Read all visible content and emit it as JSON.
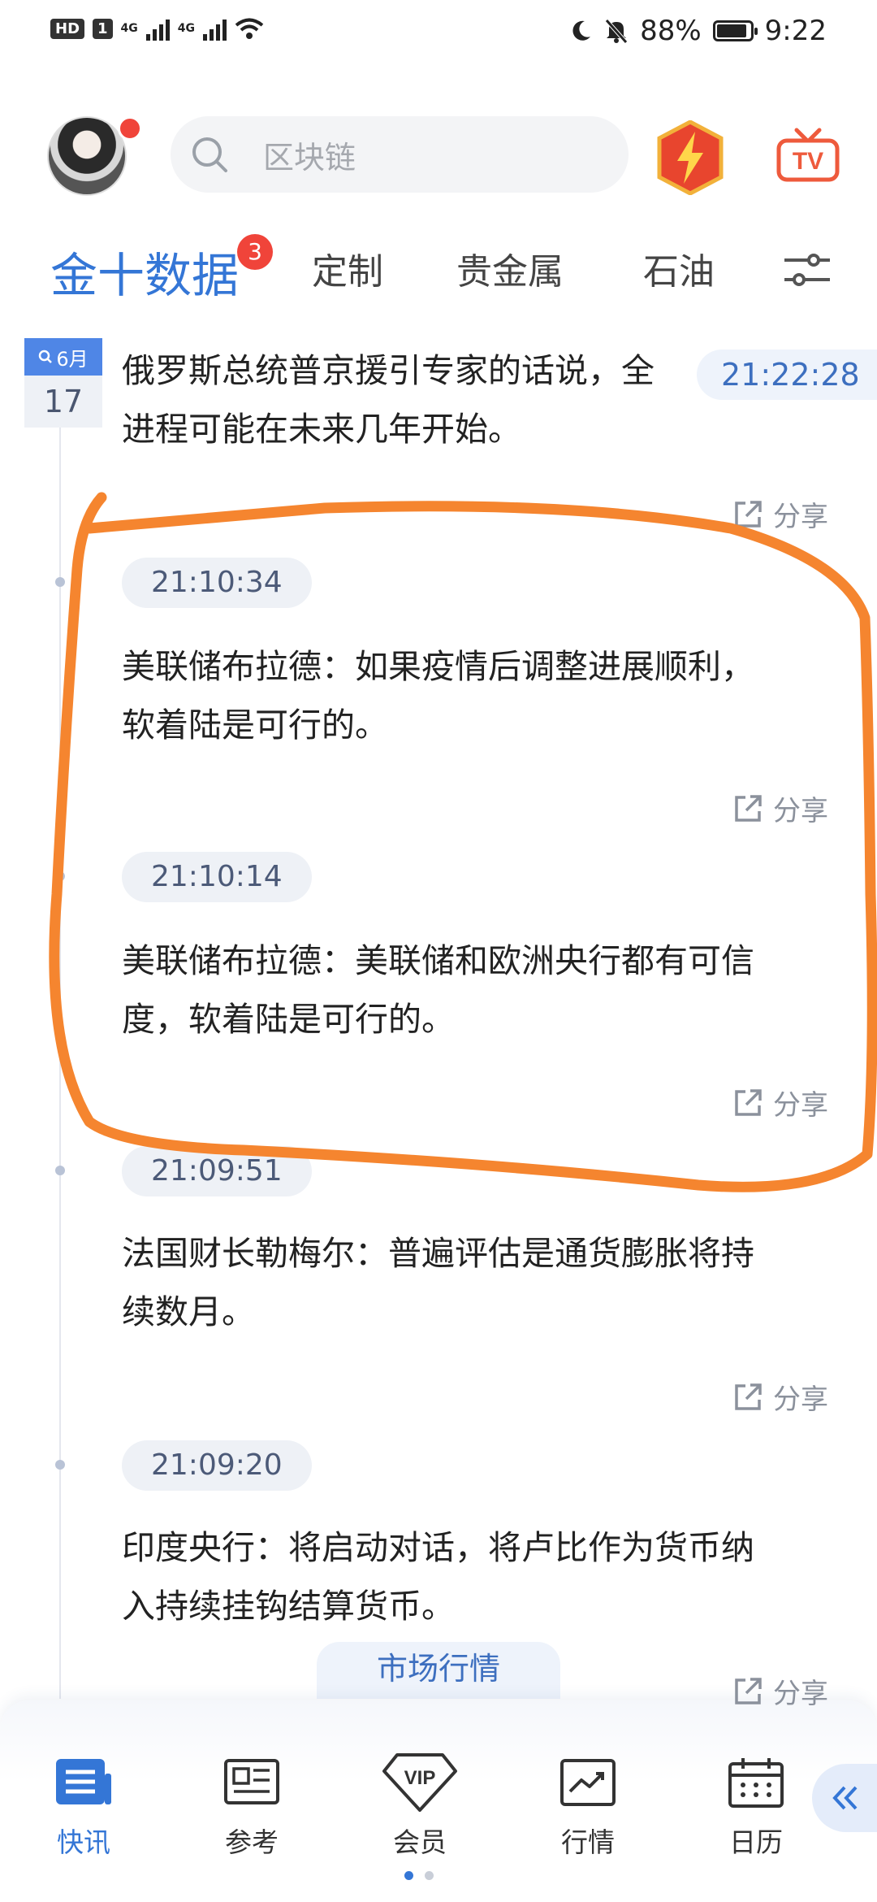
{
  "status_bar": {
    "hd": "HD",
    "sim": "1",
    "signal1": "4G",
    "signal2": "4G",
    "battery": "88%",
    "time": "9:22"
  },
  "header": {
    "search_placeholder": "区块链"
  },
  "tabs": [
    {
      "label": "金十数据",
      "badge": "3",
      "active": true
    },
    {
      "label": "定制"
    },
    {
      "label": "贵金属"
    },
    {
      "label": "石油"
    }
  ],
  "date": {
    "month": "6月",
    "day": "17"
  },
  "floating_time": "21:22:28",
  "news": [
    {
      "time": "",
      "text": [
        "俄罗斯总统普京援引专家的话说，全",
        "进程可能在未来几年开始。"
      ],
      "share": "分享"
    },
    {
      "time": "21:10:34",
      "text": [
        "美联储布拉德：如果疫情后调整进展顺利，",
        "软着陆是可行的。"
      ],
      "share": "分享"
    },
    {
      "time": "21:10:14",
      "text": [
        "美联储布拉德：美联储和欧洲央行都有可信",
        "度，软着陆是可行的。"
      ],
      "share": "分享"
    },
    {
      "time": "21:09:51",
      "text": [
        "法国财长勒梅尔：普遍评估是通货膨胀将持",
        "续数月。"
      ],
      "share": "分享"
    },
    {
      "time": "21:09:20",
      "text": [
        "印度央行：将启动对话，将卢比作为货币纳",
        "入持续挂钩结算货币。"
      ],
      "share": "分享"
    }
  ],
  "market_pill": "市场行情",
  "nav": [
    {
      "label": "快讯",
      "icon": "news-list-icon",
      "active": true
    },
    {
      "label": "参考",
      "icon": "reference-card-icon"
    },
    {
      "label": "会员",
      "icon": "vip-diamond-icon"
    },
    {
      "label": "行情",
      "icon": "market-chart-icon"
    },
    {
      "label": "日历",
      "icon": "calendar-icon"
    }
  ],
  "colors": {
    "accent": "#3476d6",
    "badge": "#f0443a",
    "scribble": "#f5852f"
  }
}
